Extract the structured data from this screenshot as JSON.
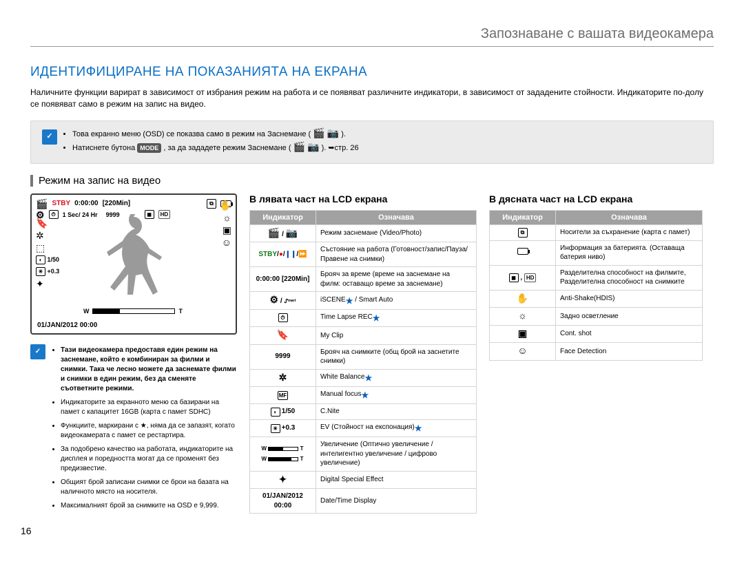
{
  "chapter": "Запознаване с вашата видеокамера",
  "page_title": "ИДЕНТИФИЦИРАНЕ НА ПОКАЗАНИЯТА НА ЕКРАНА",
  "intro": "Наличните функции варират в зависимост от избрания режим на работа и се появяват различните индикатори, в зависимост от зададените стойности. Индикаторите по-долу се появяват само в режим на запис на видео.",
  "note1": {
    "items": [
      "Това екранно меню (OSD) се показва само в режим на Заснемане (",
      "Натиснете бутона "
    ],
    "mode_label": "MODE",
    "tail1": " ).",
    "tail2": ", за да зададете режим Заснемане (",
    "tail3": " ). ➥стр. 26"
  },
  "section_header": "Режим на запис на видео",
  "lcd": {
    "stby": "STBY",
    "time": "0:00:00",
    "remain": "[220Min]",
    "line2a": "1 Sec/ 24 Hr",
    "line2b": "9999",
    "shot": "1/50",
    "ev": "+0.3",
    "datetime": "01/JAN/2012 00:00"
  },
  "col1_notes": [
    "Тази видеокамера предоставя един режим на заснемане, който е комбиниран за филми и снимки. Така че лесно можете да заснемате филми и снимки в един режим, без да сменяте съответните режими.",
    "Индикаторите за екранното меню са базирани на памет с капацитет 16GB (карта с памет SDHC)",
    "Функциите, маркирани с ★, няма да се запазят, когато видеокамерата с памет се рестартира.",
    "За подобрено качество на работата, индикаторите на дисплея и поредността могат да се променят без предизвестие.",
    "Общият брой записани снимки се брои на базата на наличното място на носителя.",
    "Максималният брой за снимките на OSD е 9,999."
  ],
  "mid_title": "В лявата част на LCD екрана",
  "right_title": "В дясната част на LCD екрана",
  "th_ind": "Индикатор",
  "th_mean": "Означава",
  "mid_rows": [
    {
      "ic": "mode",
      "txt": "Режим заснемане (Video/Photo)"
    },
    {
      "ic": "state",
      "txt": "Състояние на работа (Готовност/запис/Пауза/ Правене на снимки)"
    },
    {
      "ic": "0:00:00 [220Min]",
      "txt": "Брояч за време (време на заснемане на филм: оставащо време за заснемане)",
      "bold": true
    },
    {
      "ic": "iscene",
      "txt": "iSCENE"
    },
    {
      "ic": "timelapse",
      "txt": "Time Lapse REC"
    },
    {
      "ic": "myclip",
      "txt": "My Clip"
    },
    {
      "ic": "9999",
      "txt": "Брояч на снимките (общ брой на заснетите снимки)",
      "bold": true
    },
    {
      "ic": "wb",
      "txt": "White Balance"
    },
    {
      "ic": "mf",
      "txt": "Manual focus"
    },
    {
      "ic": "cnite",
      "txt": "C.Nite",
      "label": "1/50"
    },
    {
      "ic": "ev",
      "txt": "EV (Стойност на експонация)",
      "label": "+0.3"
    },
    {
      "ic": "zoom",
      "txt": "Увеличение (Оптично увеличение / интелигентно увеличение / цифрово увеличение)"
    },
    {
      "ic": "dse",
      "txt": "Digital Special Effect"
    },
    {
      "ic": "01/JAN/2012 00:00",
      "txt": "Date/Time Display",
      "bold": true
    }
  ],
  "mid_extra": {
    "iscene_tail": " / Smart Auto",
    "star": "★"
  },
  "right_rows": [
    {
      "ic": "storage",
      "txt": "Носители за съхранение (карта с памет)"
    },
    {
      "ic": "battery",
      "txt": "Информация за батерията. (Оставаща батерия   ниво)"
    },
    {
      "ic": "res",
      "txt": "Разделителна способност на филмите, Разделителна способност на снимките"
    },
    {
      "ic": "antishake",
      "txt": "Anti-Shake(HDIS)"
    },
    {
      "ic": "backlight",
      "txt": "Задно осветление"
    },
    {
      "ic": "contshot",
      "txt": "Cont. shot"
    },
    {
      "ic": "face",
      "txt": "Face Detection"
    }
  ],
  "page_number": "16",
  "icons": {
    "video": "🎬",
    "photo": "📷",
    "gear": "⚙",
    "smart": "ᔑᵐᵃʳᵗ",
    "card": "⧉",
    "hand": "✋",
    "face": "☺",
    "clip": "🔖",
    "wb": "✲",
    "mf": "⬚",
    "dse": "✦",
    "cont": "▣",
    "back": "☼",
    "arrow": "➜"
  }
}
